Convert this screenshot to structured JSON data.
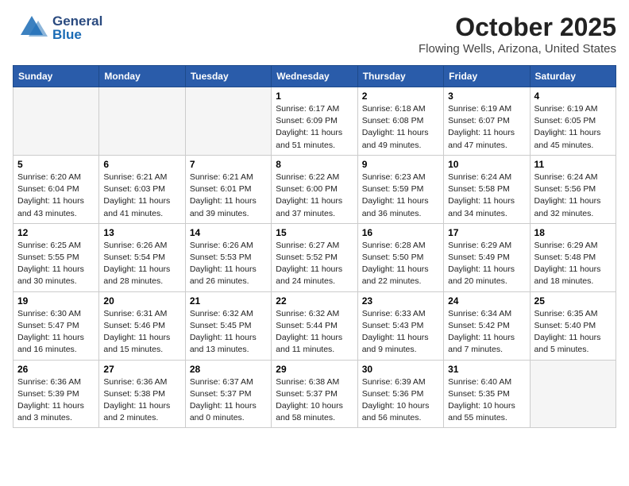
{
  "header": {
    "logo_general": "General",
    "logo_blue": "Blue",
    "month_title": "October 2025",
    "location": "Flowing Wells, Arizona, United States"
  },
  "weekdays": [
    "Sunday",
    "Monday",
    "Tuesday",
    "Wednesday",
    "Thursday",
    "Friday",
    "Saturday"
  ],
  "weeks": [
    [
      {
        "day": "",
        "info": ""
      },
      {
        "day": "",
        "info": ""
      },
      {
        "day": "",
        "info": ""
      },
      {
        "day": "1",
        "info": "Sunrise: 6:17 AM\nSunset: 6:09 PM\nDaylight: 11 hours\nand 51 minutes."
      },
      {
        "day": "2",
        "info": "Sunrise: 6:18 AM\nSunset: 6:08 PM\nDaylight: 11 hours\nand 49 minutes."
      },
      {
        "day": "3",
        "info": "Sunrise: 6:19 AM\nSunset: 6:07 PM\nDaylight: 11 hours\nand 47 minutes."
      },
      {
        "day": "4",
        "info": "Sunrise: 6:19 AM\nSunset: 6:05 PM\nDaylight: 11 hours\nand 45 minutes."
      }
    ],
    [
      {
        "day": "5",
        "info": "Sunrise: 6:20 AM\nSunset: 6:04 PM\nDaylight: 11 hours\nand 43 minutes."
      },
      {
        "day": "6",
        "info": "Sunrise: 6:21 AM\nSunset: 6:03 PM\nDaylight: 11 hours\nand 41 minutes."
      },
      {
        "day": "7",
        "info": "Sunrise: 6:21 AM\nSunset: 6:01 PM\nDaylight: 11 hours\nand 39 minutes."
      },
      {
        "day": "8",
        "info": "Sunrise: 6:22 AM\nSunset: 6:00 PM\nDaylight: 11 hours\nand 37 minutes."
      },
      {
        "day": "9",
        "info": "Sunrise: 6:23 AM\nSunset: 5:59 PM\nDaylight: 11 hours\nand 36 minutes."
      },
      {
        "day": "10",
        "info": "Sunrise: 6:24 AM\nSunset: 5:58 PM\nDaylight: 11 hours\nand 34 minutes."
      },
      {
        "day": "11",
        "info": "Sunrise: 6:24 AM\nSunset: 5:56 PM\nDaylight: 11 hours\nand 32 minutes."
      }
    ],
    [
      {
        "day": "12",
        "info": "Sunrise: 6:25 AM\nSunset: 5:55 PM\nDaylight: 11 hours\nand 30 minutes."
      },
      {
        "day": "13",
        "info": "Sunrise: 6:26 AM\nSunset: 5:54 PM\nDaylight: 11 hours\nand 28 minutes."
      },
      {
        "day": "14",
        "info": "Sunrise: 6:26 AM\nSunset: 5:53 PM\nDaylight: 11 hours\nand 26 minutes."
      },
      {
        "day": "15",
        "info": "Sunrise: 6:27 AM\nSunset: 5:52 PM\nDaylight: 11 hours\nand 24 minutes."
      },
      {
        "day": "16",
        "info": "Sunrise: 6:28 AM\nSunset: 5:50 PM\nDaylight: 11 hours\nand 22 minutes."
      },
      {
        "day": "17",
        "info": "Sunrise: 6:29 AM\nSunset: 5:49 PM\nDaylight: 11 hours\nand 20 minutes."
      },
      {
        "day": "18",
        "info": "Sunrise: 6:29 AM\nSunset: 5:48 PM\nDaylight: 11 hours\nand 18 minutes."
      }
    ],
    [
      {
        "day": "19",
        "info": "Sunrise: 6:30 AM\nSunset: 5:47 PM\nDaylight: 11 hours\nand 16 minutes."
      },
      {
        "day": "20",
        "info": "Sunrise: 6:31 AM\nSunset: 5:46 PM\nDaylight: 11 hours\nand 15 minutes."
      },
      {
        "day": "21",
        "info": "Sunrise: 6:32 AM\nSunset: 5:45 PM\nDaylight: 11 hours\nand 13 minutes."
      },
      {
        "day": "22",
        "info": "Sunrise: 6:32 AM\nSunset: 5:44 PM\nDaylight: 11 hours\nand 11 minutes."
      },
      {
        "day": "23",
        "info": "Sunrise: 6:33 AM\nSunset: 5:43 PM\nDaylight: 11 hours\nand 9 minutes."
      },
      {
        "day": "24",
        "info": "Sunrise: 6:34 AM\nSunset: 5:42 PM\nDaylight: 11 hours\nand 7 minutes."
      },
      {
        "day": "25",
        "info": "Sunrise: 6:35 AM\nSunset: 5:40 PM\nDaylight: 11 hours\nand 5 minutes."
      }
    ],
    [
      {
        "day": "26",
        "info": "Sunrise: 6:36 AM\nSunset: 5:39 PM\nDaylight: 11 hours\nand 3 minutes."
      },
      {
        "day": "27",
        "info": "Sunrise: 6:36 AM\nSunset: 5:38 PM\nDaylight: 11 hours\nand 2 minutes."
      },
      {
        "day": "28",
        "info": "Sunrise: 6:37 AM\nSunset: 5:37 PM\nDaylight: 11 hours\nand 0 minutes."
      },
      {
        "day": "29",
        "info": "Sunrise: 6:38 AM\nSunset: 5:37 PM\nDaylight: 10 hours\nand 58 minutes."
      },
      {
        "day": "30",
        "info": "Sunrise: 6:39 AM\nSunset: 5:36 PM\nDaylight: 10 hours\nand 56 minutes."
      },
      {
        "day": "31",
        "info": "Sunrise: 6:40 AM\nSunset: 5:35 PM\nDaylight: 10 hours\nand 55 minutes."
      },
      {
        "day": "",
        "info": ""
      }
    ]
  ]
}
